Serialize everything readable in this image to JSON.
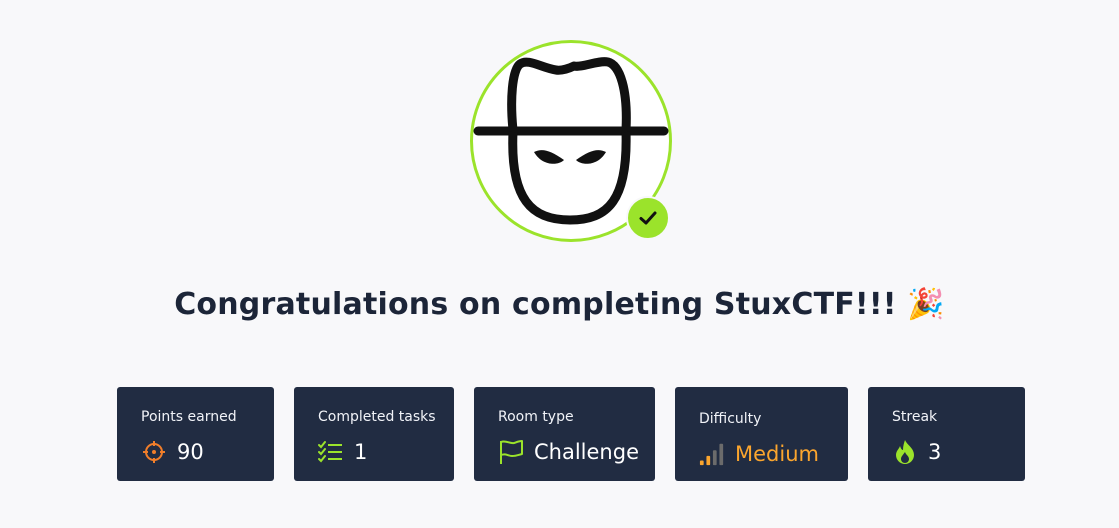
{
  "colors": {
    "background": "#f8f8fa",
    "accent_green": "#9be32b",
    "card_bg": "#212c42",
    "title": "#1c2538",
    "orange": "#f17e2a",
    "medium_yellow": "#fba52e"
  },
  "avatar": {
    "icon": "hacker-hat-icon",
    "badge_icon": "check-icon"
  },
  "title": "Congratulations on completing StuxCTF!!! 🎉",
  "stats": [
    {
      "label": "Points earned",
      "value": "90",
      "icon": "target-icon"
    },
    {
      "label": "Completed tasks",
      "value": "1",
      "icon": "checklist-icon"
    },
    {
      "label": "Room type",
      "value": "Challenge",
      "icon": "flag-icon"
    },
    {
      "label": "Difficulty",
      "value": "Medium",
      "icon": "signal-bars-icon"
    },
    {
      "label": "Streak",
      "value": "3",
      "icon": "flame-icon"
    }
  ]
}
